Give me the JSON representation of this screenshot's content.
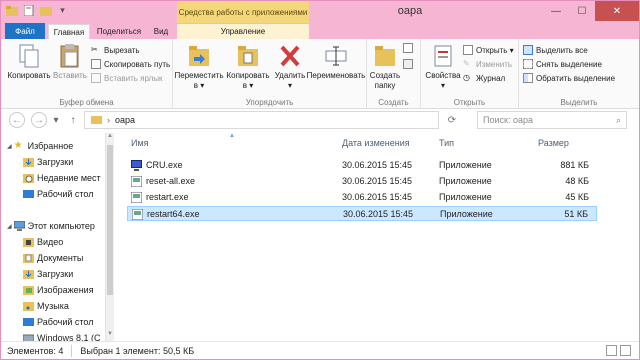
{
  "window": {
    "title": "oapa",
    "tools_context_label": "Средства работы с приложениями",
    "controls": {
      "minimize": "—",
      "maximize": "☐",
      "close": "✕"
    }
  },
  "tabs": {
    "file": "Файл",
    "home": "Главная",
    "share": "Поделиться",
    "view": "Вид",
    "manage": "Управление"
  },
  "ribbon": {
    "clipboard": {
      "copy": "Копировать",
      "paste": "Вставить",
      "cut": "Вырезать",
      "copy_path": "Скопировать путь",
      "paste_shortcut": "Вставить ярлык",
      "label": "Буфер обмена"
    },
    "organize": {
      "move_l1": "Переместить",
      "move_l2": "в ▾",
      "copy_l1": "Копировать",
      "copy_l2": "в ▾",
      "delete_l1": "Удалить",
      "delete_l2": "▾",
      "rename": "Переименовать",
      "label": "Упорядочить"
    },
    "new": {
      "new_folder_l1": "Создать",
      "new_folder_l2": "папку",
      "label": "Создать"
    },
    "open": {
      "properties_l1": "Свойства",
      "properties_l2": "▾",
      "open": "Открыть ▾",
      "edit": "Изменить",
      "history": "Журнал",
      "label": "Открыть"
    },
    "select": {
      "select_all": "Выделить все",
      "select_none": "Снять выделение",
      "invert": "Обратить выделение",
      "label": "Выделить"
    }
  },
  "addressbar": {
    "back": "←",
    "forward": "→",
    "up": "↑",
    "path": "oapa",
    "search_placeholder": "Поиск: oapa"
  },
  "navpane": {
    "items": [
      {
        "label": "Избранное"
      },
      {
        "label": "Загрузки"
      },
      {
        "label": "Недавние мест"
      },
      {
        "label": "Рабочий стол"
      },
      {
        "label": "Этот компьютер"
      },
      {
        "label": "Видео"
      },
      {
        "label": "Документы"
      },
      {
        "label": "Загрузки"
      },
      {
        "label": "Изображения"
      },
      {
        "label": "Музыка"
      },
      {
        "label": "Рабочий стол"
      },
      {
        "label": "Windows 8.1 (C"
      }
    ]
  },
  "filelist": {
    "columns": {
      "name": "Имя",
      "modified": "Дата изменения",
      "type": "Тип",
      "size": "Размер"
    },
    "rows": [
      {
        "name": "CRU.exe",
        "modified": "30.06.2015 15:45",
        "type": "Приложение",
        "size": "881 КБ",
        "selected": false
      },
      {
        "name": "reset-all.exe",
        "modified": "30.06.2015 15:45",
        "type": "Приложение",
        "size": "48 КБ",
        "selected": false
      },
      {
        "name": "restart.exe",
        "modified": "30.06.2015 15:45",
        "type": "Приложение",
        "size": "45 КБ",
        "selected": false
      },
      {
        "name": "restart64.exe",
        "modified": "30.06.2015 15:45",
        "type": "Приложение",
        "size": "51 КБ",
        "selected": true
      }
    ]
  },
  "statusbar": {
    "items_count": "Элементов: 4",
    "selected": "Выбран 1 элемент: 50,5 КБ"
  },
  "colors": {
    "file_tab": "#1e73c6",
    "title_bg": "#f7b5d4",
    "tools_tab": "#f3d77a",
    "selection": "#cce8ff"
  }
}
